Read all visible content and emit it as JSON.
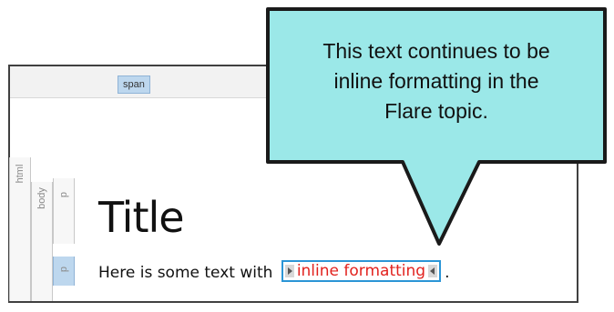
{
  "tags": {
    "span": "span",
    "html": "html",
    "body": "body",
    "p1": "p",
    "p2": "p"
  },
  "document": {
    "title": "Title",
    "para_prefix": "Here is some text with ",
    "inline_text": "inline formatting",
    "para_suffix": "."
  },
  "callout": {
    "text_line1": "This text continues to be",
    "text_line2": "inline formatting in the",
    "text_line3": "Flare topic."
  },
  "colors": {
    "callout_fill": "#9be8e8",
    "callout_border": "#1a1a1a",
    "inline_text": "#e2221e",
    "inline_border": "#2b95d6",
    "tag_highlight": "#bdd7ee"
  },
  "icons": {
    "start_marker": "start-marker-icon",
    "end_marker": "end-marker-icon"
  }
}
